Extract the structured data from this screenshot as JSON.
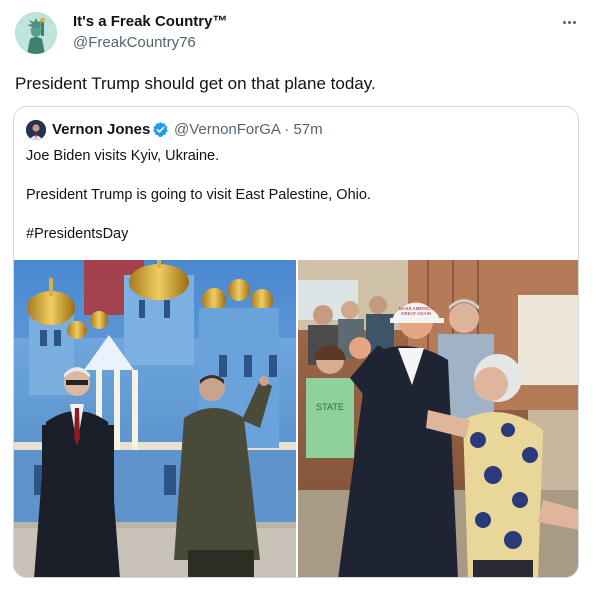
{
  "tweet": {
    "author": {
      "name": "It's a Freak Country™",
      "handle": "@FreakCountry76",
      "avatar_icon": "statue-of-liberty-avatar"
    },
    "more_icon": "more-horizontal-icon",
    "text": "President Trump should get on that plane today."
  },
  "quote": {
    "author": {
      "name": "Vernon Jones",
      "handle": "@VernonForGA",
      "time": "57m",
      "verified": true,
      "verified_color": "#1d9bf0"
    },
    "lines": [
      "Joe Biden visits Kyiv, Ukraine.",
      "President Trump is going to visit East Palestine, Ohio.",
      "#PresidentsDay"
    ],
    "media": [
      {
        "name": "biden-kyiv-photo"
      },
      {
        "name": "trump-east-palestine-photo",
        "cap_text": "MAKE AMERICA GREAT AGAIN"
      }
    ]
  },
  "colors": {
    "text_primary": "#0f1419",
    "text_secondary": "#536471",
    "border": "#cfd9de",
    "verified_blue": "#1d9bf0"
  }
}
